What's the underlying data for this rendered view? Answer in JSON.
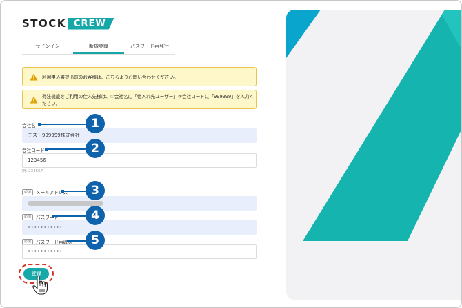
{
  "logo": {
    "stock": "STOCK",
    "crew": "CREW"
  },
  "tabs": [
    {
      "label": "サインイン",
      "active": false
    },
    {
      "label": "新規登録",
      "active": true
    },
    {
      "label": "パスワード再発行",
      "active": false
    }
  ],
  "alerts": [
    {
      "text": "利用申込書提出前のお客様は、こちらよりお問い合わせください。",
      "icon": "warning-icon"
    },
    {
      "text": "発注機能をご利用の仕入先様は、①会社名に「仕入れ先ユーザー」②会社コードに「999999」を入力ください。",
      "icon": "warning-icon"
    }
  ],
  "form": {
    "company_name_label": "会社名",
    "company_name_value": "テスト999999株式会社",
    "company_code_label": "会社コード",
    "company_code_value": "123456",
    "company_code_hint": "例: 234567",
    "required_badge": "必須",
    "email_label": "メールアドレス",
    "password_label": "パスワード",
    "password_value": "•••••••••••",
    "password_confirm_label": "パスワード再確認",
    "password_confirm_value": "•••••••••••",
    "submit_label": "登録"
  },
  "callouts": [
    "1",
    "2",
    "3",
    "4",
    "5"
  ],
  "colors": {
    "accent": "#16a7a8",
    "callout": "#0f63ad",
    "highlight": "#d6342b",
    "alert_bg": "#fdf7c9"
  }
}
